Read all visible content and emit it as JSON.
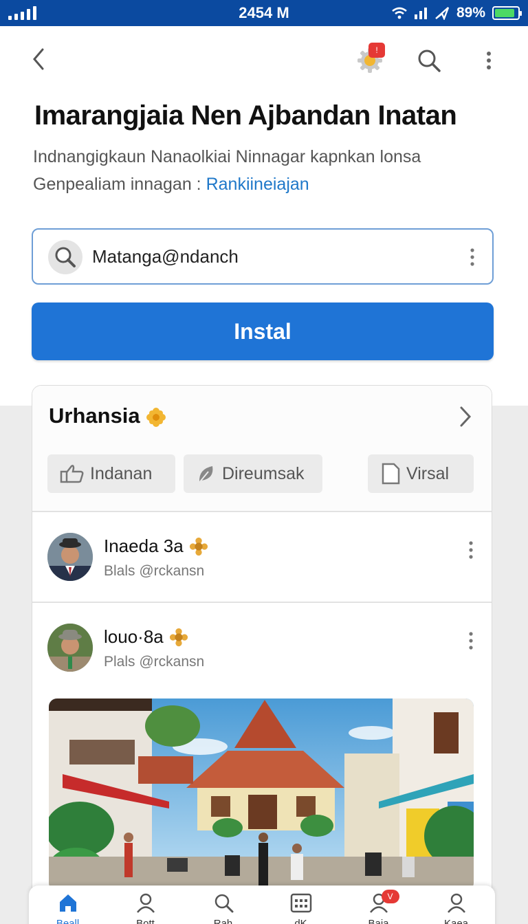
{
  "status_bar": {
    "time": "2454 M",
    "battery": "89%",
    "battery_level": 0.89
  },
  "header": {
    "notification_count": "!",
    "title": "Imarangjaia Nen Ajbandan Inatan",
    "subtitle_line1": "Indnangigkaun Nanaolkiai Ninnagar kapnkan lonsa",
    "subtitle_line2": "Genpealiam innagan :",
    "subtitle_link": "Rankiineiajan"
  },
  "search": {
    "value": "Matanga@ndanch"
  },
  "install_label": "Instal",
  "card": {
    "title": "Urhansia",
    "chips": [
      {
        "label": "Indanan",
        "icon": "thumbs-up-icon"
      },
      {
        "label": "Direumsak",
        "icon": "leaf-icon"
      },
      {
        "label": "Virsal",
        "icon": "document-icon"
      }
    ],
    "users": [
      {
        "name": "Inaeda 3a",
        "handle": "Blals @rckansn"
      },
      {
        "name": "louo·8a",
        "handle": "Plals @rckansn"
      }
    ]
  },
  "bottom_nav": {
    "items": [
      {
        "label": "Beall",
        "icon": "home-icon",
        "active": true
      },
      {
        "label": "Bott",
        "icon": "profile-icon"
      },
      {
        "label": "Rah",
        "icon": "search-icon"
      },
      {
        "label": "dK",
        "icon": "calendar-icon"
      },
      {
        "label": "Baia",
        "icon": "chat-icon",
        "badge": "V"
      },
      {
        "label": "Kaea",
        "icon": "user-icon"
      }
    ]
  },
  "colors": {
    "accent": "#1f74d6",
    "status_bar": "#0b4aa0",
    "link": "#1f78c9",
    "badge": "#e53935"
  }
}
